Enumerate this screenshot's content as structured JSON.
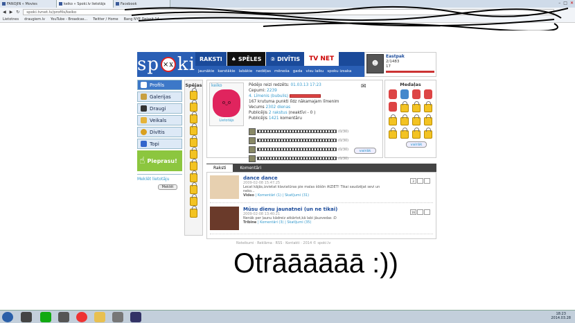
{
  "browser": {
    "tabs": [
      "FANOJIN « Movies",
      "keiko « Spoki.lv lietotājs",
      "Facebook"
    ],
    "url": "spoki.tvnet.lv/profils/keiko",
    "bookmarks": [
      "Lietotnes",
      "draugiem.lv",
      "YouTube - Broadcas...",
      "Twitter / Home",
      "Bang NYE Detroit 14..."
    ]
  },
  "site": {
    "logo": "spoki",
    "tabs": [
      "RAKSTI",
      "SPĒLES",
      "DIVĪTIS",
      "TV NET"
    ],
    "subnav": [
      "jaunākie",
      "karstākie",
      "labākie",
      "nedēļas",
      "mēneša",
      "gada",
      "visu laiku",
      "spoku izsaka"
    ],
    "user": {
      "name": "Eastpak",
      "count": "2/1483",
      "rating": "17"
    }
  },
  "menu": {
    "items": [
      "Profils",
      "Galerijas",
      "Draugi",
      "Veikals",
      "Divītis",
      "Topi"
    ],
    "pieprasu": "Pieprasu!",
    "search_label": "Meklēt lietotāju",
    "search_btn": "Meklēt"
  },
  "spejas": {
    "title": "Spējas"
  },
  "profile": {
    "username": "keiko",
    "photo_label": "Lietotājs",
    "lines": {
      "last": "Pēdējo reizi redzēts:",
      "last_v": "01.03.13 17:23",
      "cepumi": "Cepumi:",
      "cepumi_v": "2239",
      "limenis": "4. Līmenis",
      "bubulis": "(bubulis)",
      "punkti": "167 krutuma punkti līdz nākamajam līmenim",
      "vecums": "Vecums",
      "vecums_v": "2302 dienas",
      "publ": "Publicējis",
      "publ_v": "2 rakstus",
      "publ_n": "(neaktīvi - 0 )",
      "publ2": "Publicējis",
      "publ2_v": "1421",
      "publ2_t": "komentāru"
    },
    "slots": [
      "(0/30)",
      "(0/30)",
      "(0/30)",
      "(0/30)"
    ],
    "more_btn": "vairāk"
  },
  "medalas": {
    "title": "Medaļas",
    "more_btn": "vairāk"
  },
  "feed": {
    "tabs": [
      "Raksti",
      "Komentāri"
    ],
    "items": [
      {
        "title": "dance dance",
        "date": "2009-02-08 15:47:25",
        "text": "Lecat kājās,izvietat klaviatūras pie malas šōšōn AIZIET! Tikai saudzējat sevi un neko...",
        "cat": "Video",
        "links": "| Komentāri (1) | Skatījumi (31)",
        "stats": [
          "3",
          "",
          ""
        ]
      },
      {
        "title": "Mūsu dienu jaunatnei (un ne tikai)",
        "date": "2009-02-08 13:40:21",
        "text": "Nenāk per ļaunu kādreiz atkārtot,kā labi jāuzvedas :D",
        "cat": "Tribīne",
        "links": "| Komentāri (3) | Skatījumi (35)",
        "stats": [
          "16",
          "",
          ""
        ]
      }
    ]
  },
  "footer": "Noteikumi · Reklāma · RSS · Kontakti · 2014 © spoki.lv",
  "caption": "Otrāāāāāā :))",
  "clock": {
    "time": "18:23",
    "date": "2014.03.28"
  }
}
